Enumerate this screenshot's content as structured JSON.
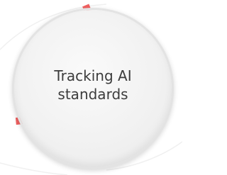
{
  "card": {
    "title_lines": [
      "Tracking AI",
      "standards"
    ],
    "accent_color": "#f06161",
    "disc_color": "#f1f1f1",
    "text_color": "#3c3c3c",
    "progress_fraction": 0.3
  }
}
